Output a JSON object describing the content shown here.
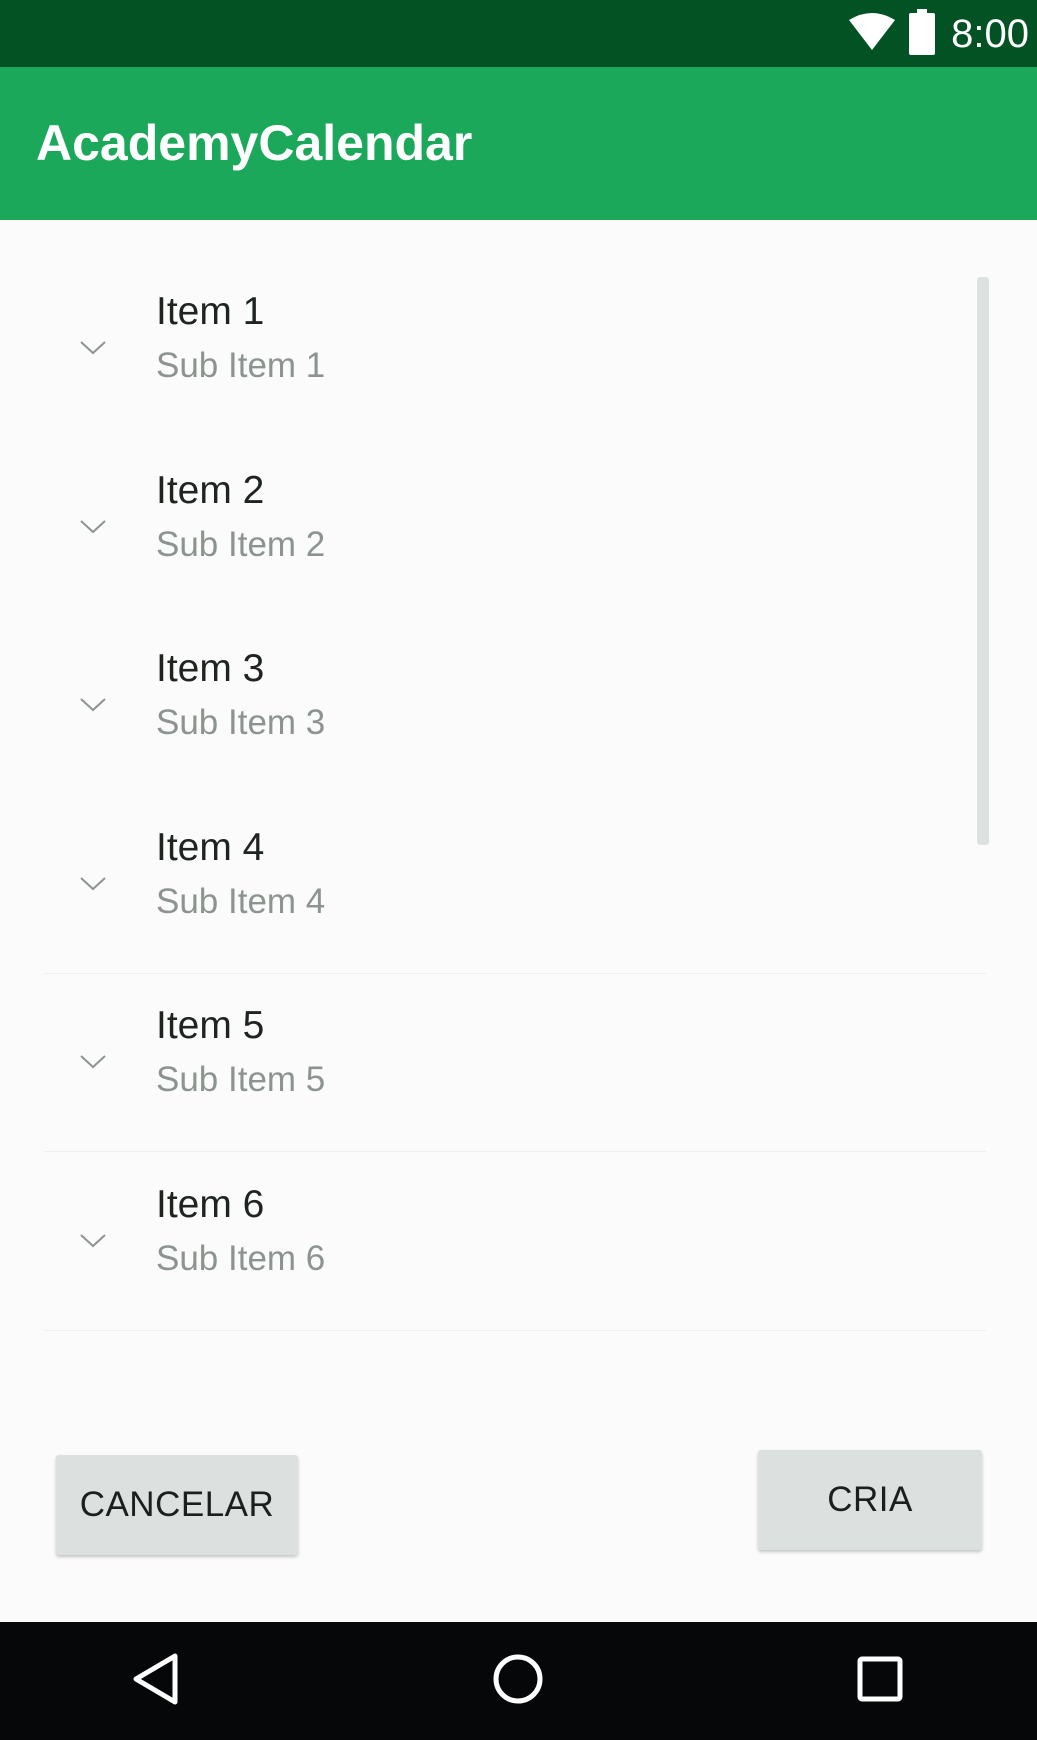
{
  "status_bar": {
    "time": "8:00",
    "icons": [
      "wifi-icon",
      "battery-icon"
    ],
    "color": "#035224"
  },
  "app_bar": {
    "title": "AcademyCalendar",
    "color": "#1ba85a"
  },
  "list": {
    "items": [
      {
        "title": "Item 1",
        "subtitle": "Sub Item 1",
        "icon": "chevron-down-icon"
      },
      {
        "title": "Item 2",
        "subtitle": "Sub Item 2",
        "icon": "chevron-down-icon"
      },
      {
        "title": "Item 3",
        "subtitle": "Sub Item 3",
        "icon": "chevron-down-icon"
      },
      {
        "title": "Item 4",
        "subtitle": "Sub Item 4",
        "icon": "chevron-down-icon"
      },
      {
        "title": "Item 5",
        "subtitle": "Sub Item 5",
        "icon": "chevron-down-icon"
      },
      {
        "title": "Item 6",
        "subtitle": "Sub Item 6",
        "icon": "chevron-down-icon"
      }
    ]
  },
  "actions": {
    "cancel_label": "CANCELAR",
    "create_label": "CRIA"
  },
  "nav_bar": {
    "icons": [
      "back-icon",
      "home-icon",
      "recents-icon"
    ]
  }
}
